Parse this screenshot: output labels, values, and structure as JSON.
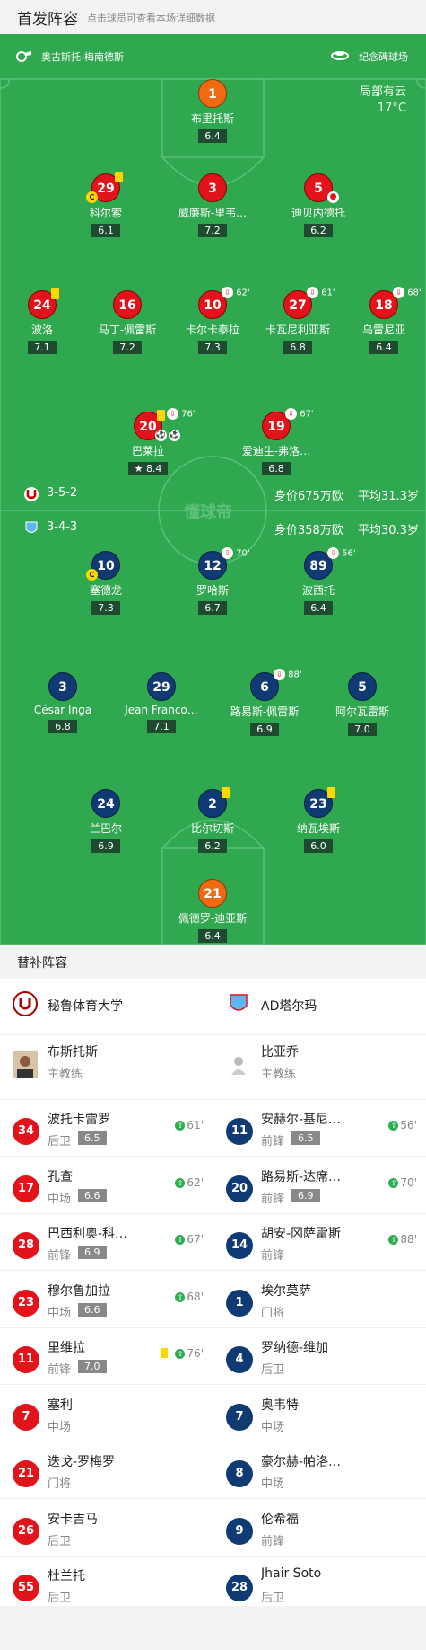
{
  "header": {
    "title": "首发阵容",
    "subtitle": "点击球员可查看本场详细数据"
  },
  "pitch_info": {
    "referee": "奥古斯托-梅南德斯",
    "venue": "纪念碑球场",
    "weather": "局部有云",
    "temperature": "17°C",
    "watermark": "懂球帝"
  },
  "home_team": {
    "name": "秘鲁体育大学",
    "formation": "3-5-2",
    "value": "身价675万欧",
    "avg_age": "平均31.3岁",
    "color": "#e3131c",
    "players": [
      {
        "num": "1",
        "name": "布里托斯",
        "rating": "6.4",
        "gk": true
      },
      {
        "num": "29",
        "name": "科尔索",
        "rating": "6.1"
      },
      {
        "num": "3",
        "name": "威廉斯-里韦…",
        "rating": "7.2"
      },
      {
        "num": "5",
        "name": "迪贝内德托",
        "rating": "6.2"
      },
      {
        "num": "24",
        "name": "波洛",
        "rating": "7.1"
      },
      {
        "num": "16",
        "name": "马丁-佩雷斯",
        "rating": "7.2"
      },
      {
        "num": "10",
        "name": "卡尔卡泰拉",
        "rating": "7.3",
        "sub": "62'"
      },
      {
        "num": "27",
        "name": "卡瓦尼利亚斯",
        "rating": "6.8",
        "sub": "61'"
      },
      {
        "num": "18",
        "name": "乌雷尼亚",
        "rating": "6.4",
        "sub": "68'"
      },
      {
        "num": "20",
        "name": "巴莱拉",
        "rating": "8.4",
        "sub": "76'"
      },
      {
        "num": "19",
        "name": "爱迪生-弗洛…",
        "rating": "6.8",
        "sub": "67'"
      }
    ]
  },
  "away_team": {
    "name": "AD塔尔玛",
    "formation": "3-4-3",
    "value": "身价358万欧",
    "avg_age": "平均30.3岁",
    "color": "#0f3a73",
    "players": [
      {
        "num": "10",
        "name": "塞德龙",
        "rating": "7.3"
      },
      {
        "num": "12",
        "name": "罗哈斯",
        "rating": "6.7",
        "sub": "70'"
      },
      {
        "num": "89",
        "name": "波西托",
        "rating": "6.4",
        "sub": "56'"
      },
      {
        "num": "3",
        "name": "César Inga",
        "rating": "6.8"
      },
      {
        "num": "29",
        "name": "Jean Franco…",
        "rating": "7.1"
      },
      {
        "num": "6",
        "name": "路易斯-佩雷斯",
        "rating": "6.9",
        "sub": "88'"
      },
      {
        "num": "5",
        "name": "阿尔瓦雷斯",
        "rating": "7.0"
      },
      {
        "num": "24",
        "name": "兰巴尔",
        "rating": "6.9"
      },
      {
        "num": "2",
        "name": "比尔切斯",
        "rating": "6.2"
      },
      {
        "num": "23",
        "name": "纳瓦埃斯",
        "rating": "6.0"
      },
      {
        "num": "21",
        "name": "佩德罗-迪亚斯",
        "rating": "6.4",
        "gk": true
      }
    ]
  },
  "captain_label": "C",
  "subs_title": "替补阵容",
  "home_coach": {
    "name": "布斯托斯",
    "role": "主教练"
  },
  "away_coach": {
    "name": "比亚乔",
    "role": "主教练"
  },
  "home_subs": [
    {
      "num": "34",
      "name": "波托卡雷罗",
      "pos": "后卫",
      "rating": "6.5",
      "min": "61'"
    },
    {
      "num": "17",
      "name": "孔查",
      "pos": "中场",
      "rating": "6.6",
      "min": "62'"
    },
    {
      "num": "28",
      "name": "巴西利奥-科…",
      "pos": "前锋",
      "rating": "6.9",
      "min": "67'"
    },
    {
      "num": "23",
      "name": "穆尔鲁加拉",
      "pos": "中场",
      "rating": "6.6",
      "min": "68'"
    },
    {
      "num": "11",
      "name": "里维拉",
      "pos": "前锋",
      "rating": "7.0",
      "min": "76'",
      "yellow": true
    },
    {
      "num": "7",
      "name": "塞利",
      "pos": "中场"
    },
    {
      "num": "21",
      "name": "迭戈-罗梅罗",
      "pos": "门将"
    },
    {
      "num": "26",
      "name": "安卡吉马",
      "pos": "后卫"
    },
    {
      "num": "55",
      "name": "杜兰托",
      "pos": "后卫"
    }
  ],
  "away_subs": [
    {
      "num": "11",
      "name": "安赫尔-基尼…",
      "pos": "前锋",
      "rating": "6.5",
      "min": "56'"
    },
    {
      "num": "20",
      "name": "路易斯-达席…",
      "pos": "前锋",
      "rating": "6.9",
      "min": "70'"
    },
    {
      "num": "14",
      "name": "胡安-冈萨雷斯",
      "pos": "前锋",
      "min": "88'"
    },
    {
      "num": "1",
      "name": "埃尔莫萨",
      "pos": "门将"
    },
    {
      "num": "4",
      "name": "罗纳德-维加",
      "pos": "后卫"
    },
    {
      "num": "7",
      "name": "奥韦特",
      "pos": "中场"
    },
    {
      "num": "8",
      "name": "豪尔赫-帕洛…",
      "pos": "中场"
    },
    {
      "num": "9",
      "name": "伦希福",
      "pos": "前锋"
    },
    {
      "num": "28",
      "name": "Jhair Soto",
      "pos": "后卫"
    }
  ]
}
